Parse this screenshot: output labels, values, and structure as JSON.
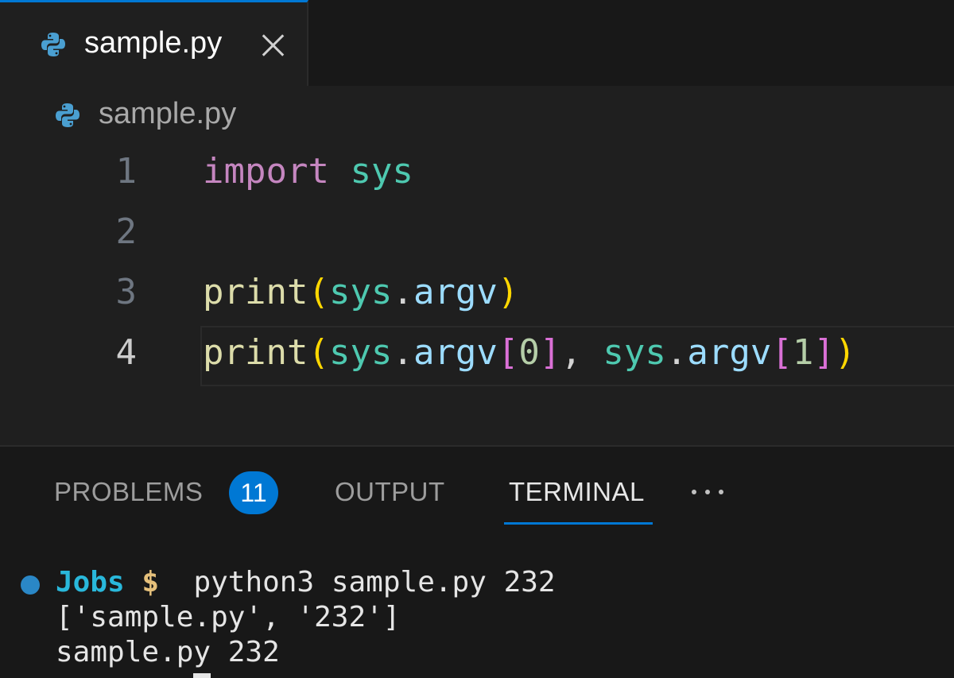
{
  "colors": {
    "accent": "#0078d4",
    "keyword": "#c586c0",
    "module": "#4ec9b0",
    "function": "#dcdcaa",
    "bracket_level1": "#ffd700",
    "bracket_level2": "#da70d6",
    "attribute": "#9cdcfe",
    "number": "#b5cea8",
    "prompt_dir": "#29b8db",
    "prompt_sign": "#e5c07b"
  },
  "tab": {
    "title": "sample.py",
    "icon": "python-icon",
    "close_icon": "close-icon"
  },
  "breadcrumb": {
    "label": "sample.py",
    "icon": "python-icon"
  },
  "editor": {
    "active_line": 4,
    "lines": [
      {
        "number": "1",
        "tokens": {
          "kw": "import",
          "sp": " ",
          "mod": "sys"
        }
      },
      {
        "number": "2"
      },
      {
        "number": "3",
        "tokens": {
          "fn": "print",
          "p1": "(",
          "mod": "sys",
          "dot": ".",
          "attr": "argv",
          "p2": ")"
        }
      },
      {
        "number": "4",
        "tokens": {
          "fn": "print",
          "p1": "(",
          "mod1": "sys",
          "dot1": ".",
          "attr1": "argv",
          "b1": "[",
          "n1": "0",
          "b2": "]",
          "comma": ", ",
          "mod2": "sys",
          "dot2": ".",
          "attr2": "argv",
          "b3": "[",
          "n2": "1",
          "b4": "]",
          "p2": ")"
        }
      }
    ]
  },
  "panel": {
    "tabs": [
      "PROBLEMS",
      "OUTPUT",
      "TERMINAL"
    ],
    "active_tab": "TERMINAL",
    "problems_count": "11",
    "more_icon": "more-icon"
  },
  "terminal": {
    "prompt_dir": "Jobs",
    "prompt_sign": "$",
    "command": "python3 sample.py 232",
    "output": [
      "['sample.py', '232']",
      "sample.py 232"
    ]
  }
}
